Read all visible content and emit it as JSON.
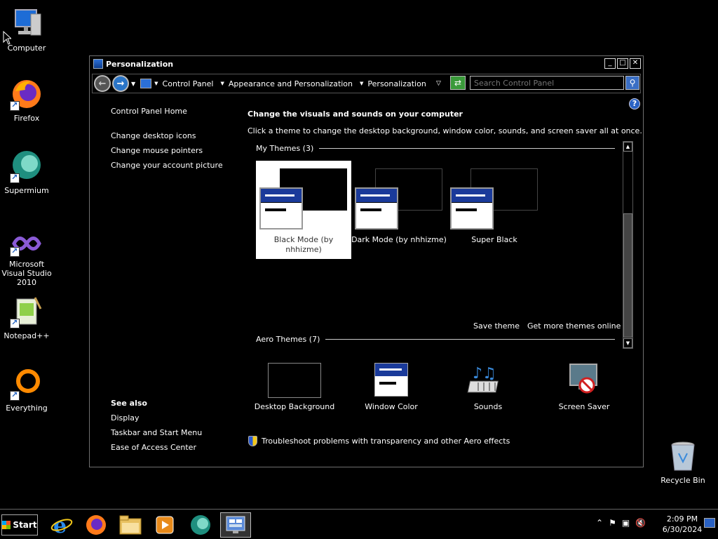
{
  "desktop": {
    "icons": [
      {
        "label": "Computer",
        "icon": "computer-icon"
      },
      {
        "label": "Firefox",
        "icon": "firefox-icon"
      },
      {
        "label": "Supermium",
        "icon": "supermium-icon"
      },
      {
        "label": "Microsoft Visual Studio 2010",
        "icon": "visual-studio-icon"
      },
      {
        "label": "Notepad++",
        "icon": "notepadpp-icon"
      },
      {
        "label": "Everything",
        "icon": "everything-icon"
      },
      {
        "label": "Recycle Bin",
        "icon": "recycle-bin-icon"
      }
    ]
  },
  "window": {
    "title": "Personalization",
    "controls": {
      "minimize": "_",
      "maximize": "□",
      "close": "✕"
    }
  },
  "navbar": {
    "breadcrumbs": [
      "Control Panel",
      "Appearance and Personalization",
      "Personalization"
    ],
    "search_placeholder": "Search Control Panel"
  },
  "left_pane": {
    "links": [
      "Control Panel Home",
      "Change desktop icons",
      "Change mouse pointers",
      "Change your account picture"
    ],
    "see_also_title": "See also",
    "see_also_links": [
      "Display",
      "Taskbar and Start Menu",
      "Ease of Access Center"
    ]
  },
  "main": {
    "title": "Change the visuals and sounds on your computer",
    "description": "Click a theme to change the desktop background, window color, sounds, and screen saver all at once.",
    "my_themes_header": "My Themes (3)",
    "my_themes": [
      {
        "name": "Black Mode (by nhhizme)",
        "selected": true
      },
      {
        "name": "Dark Mode (by nhhizme)",
        "selected": false
      },
      {
        "name": "Super Black",
        "selected": false
      }
    ],
    "save_theme": "Save theme",
    "get_more_themes": "Get more themes online",
    "aero_themes_header": "Aero Themes (7)",
    "bottom_items": [
      {
        "label": "Desktop Background",
        "icon": "desktop-background-icon"
      },
      {
        "label": "Window Color",
        "icon": "window-color-icon"
      },
      {
        "label": "Sounds",
        "icon": "sounds-icon"
      },
      {
        "label": "Screen Saver",
        "icon": "screen-saver-icon"
      }
    ],
    "troubleshoot": "Troubleshoot problems with transparency and other Aero effects"
  },
  "taskbar": {
    "start_label": "Start",
    "apps": [
      "internet-explorer-icon",
      "firefox-icon",
      "file-explorer-icon",
      "media-player-icon",
      "supermium-icon",
      "control-panel-icon"
    ],
    "active_app": "control-panel-icon",
    "time": "2:09 PM",
    "date": "6/30/2024"
  },
  "colors": {
    "background": "#000000",
    "accent_blue": "#1a3a9a",
    "text": "#ffffff"
  }
}
